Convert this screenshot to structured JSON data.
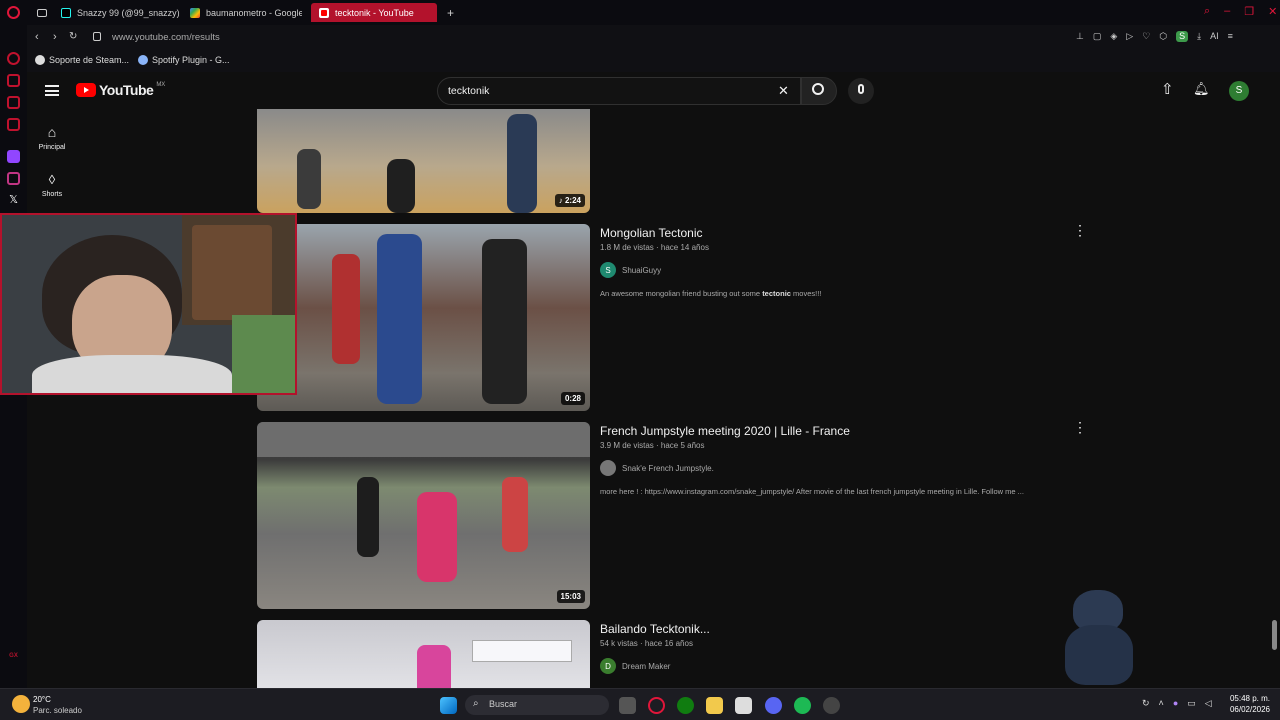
{
  "browser": {
    "tabs": [
      {
        "label": "Snazzy 99 (@99_snazzy)"
      },
      {
        "label": "baumanometro - Google S"
      },
      {
        "label": "tecktonik - YouTube"
      }
    ],
    "url": "www.youtube.com/results",
    "bookmarks": [
      {
        "label": "Soporte de Steam..."
      },
      {
        "label": "Spotify Plugin - G..."
      }
    ],
    "toolbar_ai": "AI",
    "profile_letter": "S"
  },
  "youtube": {
    "logo_text": "YouTube",
    "region": "MX",
    "search_value": "tecktonik",
    "avatar_letter": "S",
    "sidebar": [
      {
        "label": "Principal"
      },
      {
        "label": "Shorts"
      }
    ],
    "videos": [
      {
        "duration": "2:24"
      },
      {
        "title": "Mongolian Tectonic",
        "meta": "1.8 M de vistas · hace 14 años",
        "channel": "ShuaiGuyy",
        "channel_initial": "S",
        "desc_before": "An awesome mongolian friend busting out some ",
        "desc_bold": "tectonic",
        "desc_after": " moves!!!",
        "duration": "0:28"
      },
      {
        "title": "French Jumpstyle meeting 2020 | Lille - France",
        "meta": "3.9 M de vistas · hace 5 años",
        "channel": "Snak'e French Jumpstyle.",
        "channel_initial": "",
        "desc": "more here ! : https://www.instagram.com/snake_jumpstyle/ After movie of the last french jumpstyle meeting in Lille. Follow me ...",
        "duration": "15:03"
      },
      {
        "title": "Bailando Tecktonik...",
        "meta": "54 k vistas · hace 16 años",
        "channel": "Dream Maker",
        "channel_initial": "D"
      }
    ]
  },
  "taskbar": {
    "weather_temp": "20°C",
    "weather_desc": "Parc. soleado",
    "search_label": "Buscar",
    "time": "05:48 p. m.",
    "date": "06/02/2026"
  },
  "colors": {
    "accent": "#b3122c",
    "page_bg": "#0f0f0f",
    "yt_red": "#ff0000"
  }
}
